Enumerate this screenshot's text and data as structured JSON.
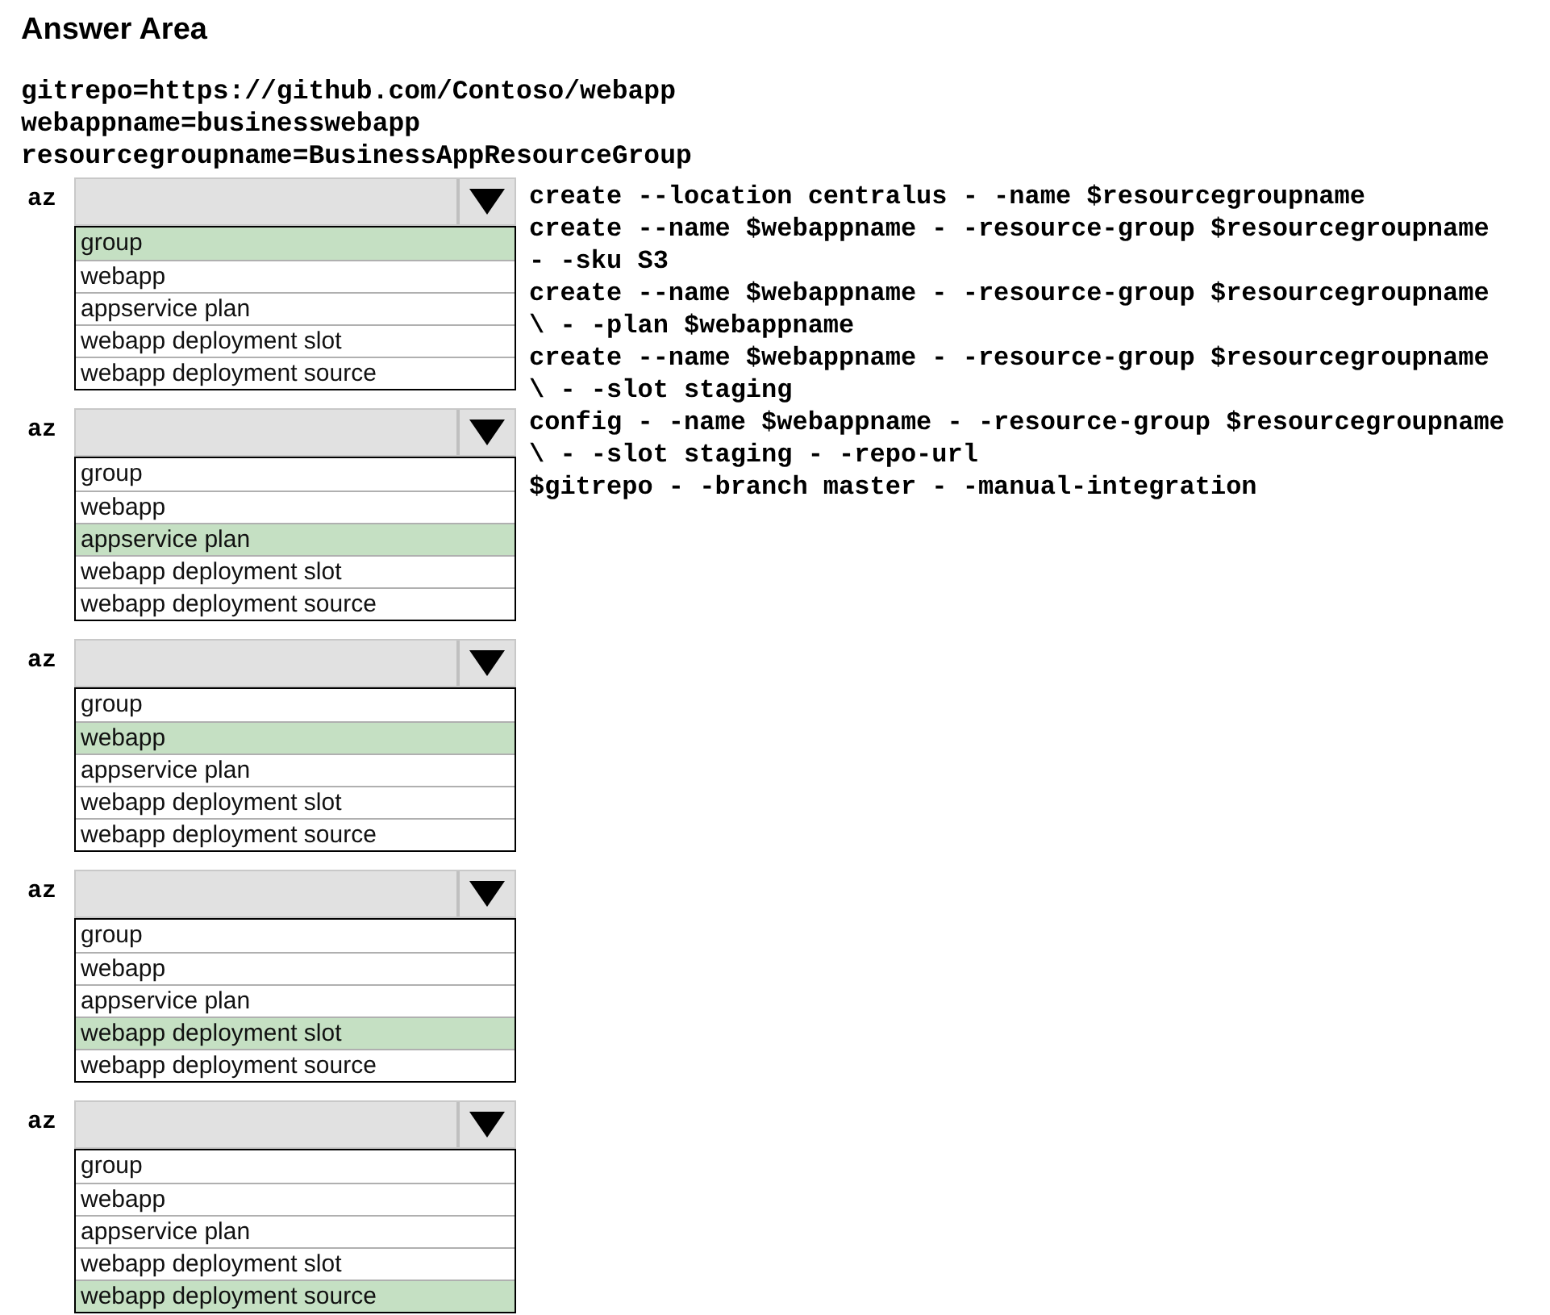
{
  "title": "Answer Area",
  "variables": [
    "gitrepo=https://github.com/Contoso/webapp",
    "webappname=businesswebapp",
    "resourcegroupname=BusinessAppResourceGroup"
  ],
  "dropdowns": [
    {
      "prefix": "az",
      "options": [
        {
          "label": "group",
          "selected": true
        },
        {
          "label": "webapp",
          "selected": false
        },
        {
          "label": "appservice plan",
          "selected": false
        },
        {
          "label": "webapp deployment slot",
          "selected": false
        },
        {
          "label": "webapp deployment source",
          "selected": false
        }
      ]
    },
    {
      "prefix": "az",
      "options": [
        {
          "label": "group",
          "selected": false
        },
        {
          "label": "webapp",
          "selected": false
        },
        {
          "label": "appservice plan",
          "selected": true
        },
        {
          "label": "webapp deployment slot",
          "selected": false
        },
        {
          "label": "webapp deployment source",
          "selected": false
        }
      ]
    },
    {
      "prefix": "az",
      "options": [
        {
          "label": "group",
          "selected": false
        },
        {
          "label": "webapp",
          "selected": true
        },
        {
          "label": "appservice plan",
          "selected": false
        },
        {
          "label": "webapp deployment slot",
          "selected": false
        },
        {
          "label": "webapp deployment source",
          "selected": false
        }
      ]
    },
    {
      "prefix": "az",
      "options": [
        {
          "label": "group",
          "selected": false
        },
        {
          "label": "webapp",
          "selected": false
        },
        {
          "label": "appservice plan",
          "selected": false
        },
        {
          "label": "webapp deployment slot",
          "selected": true
        },
        {
          "label": "webapp deployment source",
          "selected": false
        }
      ]
    },
    {
      "prefix": "az",
      "options": [
        {
          "label": "group",
          "selected": false
        },
        {
          "label": "webapp",
          "selected": false
        },
        {
          "label": "appservice plan",
          "selected": false
        },
        {
          "label": "webapp deployment slot",
          "selected": false
        },
        {
          "label": "webapp deployment source",
          "selected": true
        }
      ]
    }
  ],
  "code_lines": [
    "create --location centralus - -name $resourcegroupname",
    "create --name $webappname - -resource-group $resourcegroupname",
    "- -sku S3",
    "create --name $webappname - -resource-group $resourcegroupname",
    "\\ - -plan $webappname",
    "create --name $webappname - -resource-group $resourcegroupname",
    "\\ - -slot staging",
    "config - -name $webappname - -resource-group $resourcegroupname",
    "\\ - -slot staging - -repo-url",
    "$gitrepo - -branch master - -manual-integration"
  ]
}
